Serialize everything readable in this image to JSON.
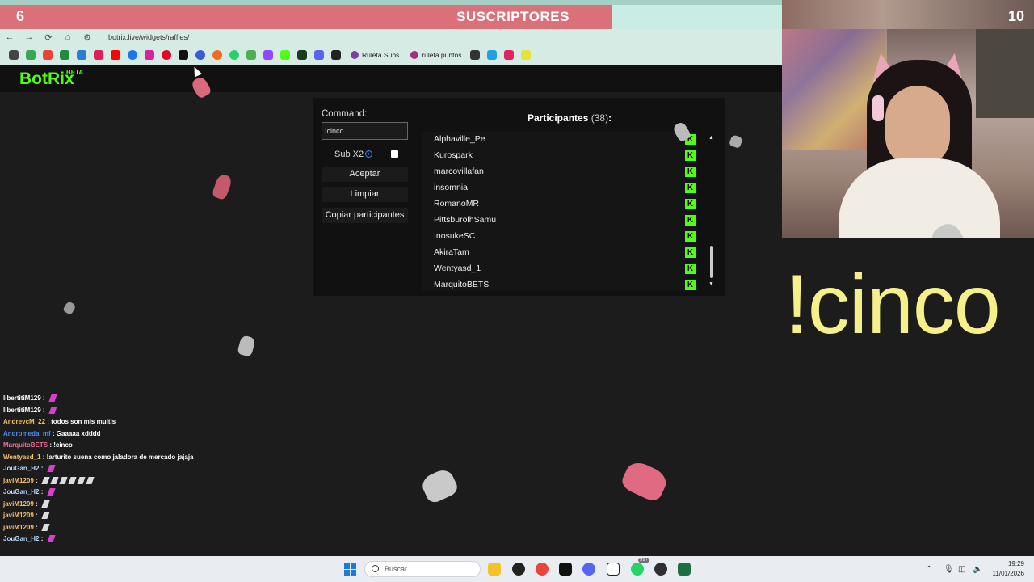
{
  "sub_goal": {
    "current": "6",
    "target": "10",
    "title": "SUSCRIPTORES",
    "progress": 0.6
  },
  "browser": {
    "url": "botrix.live/widgets/raffles/",
    "bookmarks_text": [
      "Ruleta Subs",
      "ruleta puntos"
    ]
  },
  "botrix": {
    "logo": "BotRix",
    "beta": "BETA",
    "command_label": "Command:",
    "command_value": "!cinco",
    "subx2_label": "Sub X2",
    "subx2_info": "i",
    "buttons": {
      "accept": "Aceptar",
      "clear": "Limpiar",
      "copy": "Copiar participantes"
    },
    "participants_label": "Participantes",
    "participants_count": "(38)",
    "participants_colon": ":",
    "participants": [
      "Alphaville_Pe",
      "Kurospark",
      "marcovillafan",
      "insomnia",
      "RomanoMR",
      "PittsburolhSamu",
      "InosukeSC",
      "AkiraTam",
      "Wentyasd_1",
      "MarquitoBETS"
    ],
    "kick_badge": "K"
  },
  "chat": [
    {
      "user": "libertitiM129",
      "color": "#ffffff",
      "msg": "",
      "emotes": 1
    },
    {
      "user": "libertitiM129",
      "color": "#ffffff",
      "msg": "",
      "emotes": 1
    },
    {
      "user": "AndrevcM_22",
      "color": "#f6c26b",
      "msg": "todos son mis multis",
      "emotes": 0
    },
    {
      "user": "Andromeda_mf",
      "color": "#4a8ff0",
      "msg": "Gaaaaa xdddd",
      "emotes": 0
    },
    {
      "user": "MarquitoBETS",
      "color": "#e86f93",
      "msg": "!cinco",
      "emotes": 0
    },
    {
      "user": "Wentyasd_1",
      "color": "#f6c26b",
      "msg": "!arturito suena como jaladora de mercado jajaja",
      "emotes": 0
    },
    {
      "user": "JouGan_H2",
      "color": "#b9d9ff",
      "msg": "",
      "emotes": 1
    },
    {
      "user": "javiM1209",
      "color": "#f6c26b",
      "msg": "",
      "emotes": 6
    },
    {
      "user": "JouGan_H2",
      "color": "#b9d9ff",
      "msg": "",
      "emotes": 1
    },
    {
      "user": "javiM1209",
      "color": "#f6c26b",
      "msg": "",
      "emotes": 1
    },
    {
      "user": "javiM1209",
      "color": "#f6c26b",
      "msg": "",
      "emotes": 1
    },
    {
      "user": "javiM1209",
      "color": "#f6c26b",
      "msg": "",
      "emotes": 1
    },
    {
      "user": "JouGan_H2",
      "color": "#b9d9ff",
      "msg": "",
      "emotes": 1
    }
  ],
  "overlay_command": "!cinco",
  "taskbar": {
    "search_placeholder": "Buscar",
    "whatsapp_badge": "99+",
    "time": "19:29",
    "date": "11/01/2026"
  },
  "colors": {
    "kick_green": "#53fc18",
    "progress_fill": "#d9707a",
    "command_overlay": "#f5f08a"
  }
}
